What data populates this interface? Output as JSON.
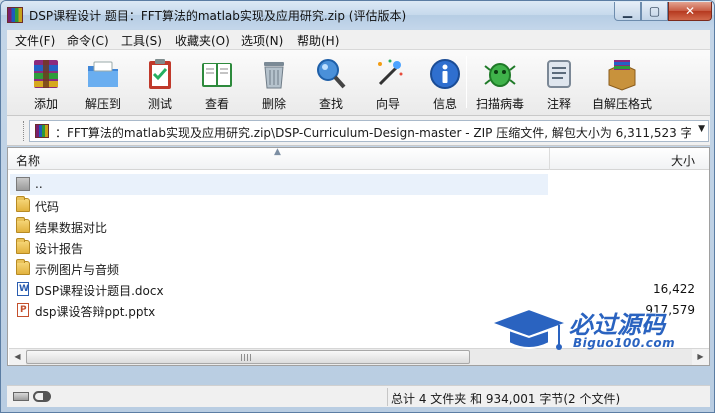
{
  "window": {
    "title": "DSP课程设计 题目：FFT算法的matlab实现及应用研究.zip (评估版本)"
  },
  "menu": [
    {
      "label": "文件(F)"
    },
    {
      "label": "命令(C)"
    },
    {
      "label": "工具(S)"
    },
    {
      "label": "收藏夹(O)"
    },
    {
      "label": "选项(N)"
    },
    {
      "label": "帮助(H)"
    }
  ],
  "toolbar": [
    {
      "label": "添加",
      "icon": "add-archive-icon"
    },
    {
      "label": "解压到",
      "icon": "extract-folder-icon"
    },
    {
      "label": "测试",
      "icon": "test-clipboard-icon"
    },
    {
      "label": "查看",
      "icon": "view-book-icon"
    },
    {
      "label": "删除",
      "icon": "trash-icon"
    },
    {
      "label": "查找",
      "icon": "magnifier-icon"
    },
    {
      "label": "向导",
      "icon": "wizard-wand-icon"
    },
    {
      "label": "信息",
      "icon": "info-icon"
    },
    {
      "label": "扫描病毒",
      "icon": "virus-scan-icon"
    },
    {
      "label": "注释",
      "icon": "comment-icon"
    },
    {
      "label": "自解压格式",
      "icon": "sfx-box-icon"
    }
  ],
  "address": {
    "path": "：FFT算法的matlab实现及应用研究.zip\\DSP-Curriculum-Design-master - ZIP 压缩文件, 解包大小为 6,311,523 字节"
  },
  "columns": {
    "name": "名称",
    "size": "大小"
  },
  "files": [
    {
      "name": "..",
      "size": "",
      "type": "up"
    },
    {
      "name": "代码",
      "size": "",
      "type": "folder"
    },
    {
      "name": "结果数据对比",
      "size": "",
      "type": "folder"
    },
    {
      "name": "设计报告",
      "size": "",
      "type": "folder"
    },
    {
      "name": "示例图片与音频",
      "size": "",
      "type": "folder"
    },
    {
      "name": "DSP课程设计题目.docx",
      "size": "16,422",
      "type": "docx"
    },
    {
      "name": "dsp课设答辩ppt.pptx",
      "size": "917,579",
      "type": "pptx"
    }
  ],
  "watermark": {
    "title": "必过源码",
    "subtitle": "Biguo100.com"
  },
  "status": {
    "summary": "总计 4 文件夹 和 934,001 字节(2 个文件)"
  },
  "colors": {
    "title_bar": "#c6d9ec",
    "close_button": "#c75b43",
    "watermark": "#2a63c0",
    "selection": "#e9f1fb"
  }
}
